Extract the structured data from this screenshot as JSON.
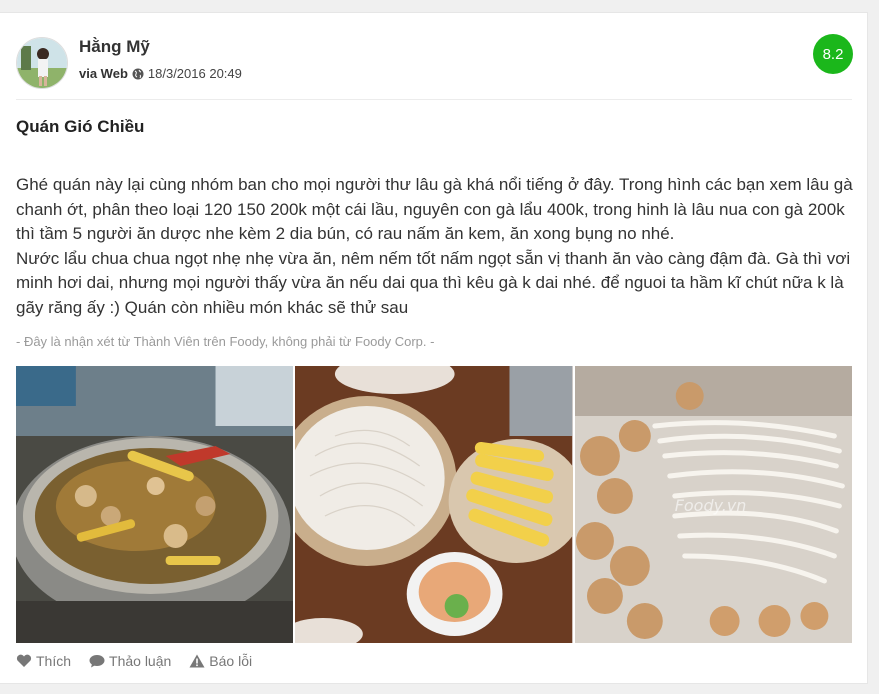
{
  "review": {
    "user": {
      "name": "Hằng Mỹ",
      "via": "via Web",
      "datetime": "18/3/2016 20:49"
    },
    "score": "8.2",
    "title": "Quán Gió Chiều",
    "body": [
      "Ghé quán này lại cùng nhóm ban cho mọi người thư lâu gà khá nổi tiếng ở đây. Trong hình các bạn xem lâu gà chanh ớt, phân theo loại 120 150 200k một cái lầu, nguyên con gà lẩu 400k, trong hinh là lâu nua con gà 200k thì tầm 5 người ăn dược nhe kèm 2 dia bún, có rau nấm ăn kem, ăn xong bụng no nhé.",
      "Nước lẩu chua chua ngọt nhẹ nhẹ vừa ăn, nêm nếm tốt nấm ngọt sẵn vị thanh ăn vào càng đậm đà. Gà thì vơi minh hơi dai, nhưng mọi người thấy vừa ăn nếu dai qua thì kêu gà k dai nhé. để nguoi ta hầm kĩ chút nữa k là gãy răng ấy :) Quán còn nhiều món khác sẽ thử sau"
    ],
    "disclaimer": "- Đây là nhận xét từ Thành Viên trên Foody, không phải từ Foody Corp. -",
    "photos": [
      {
        "icon": "chicken-hotpot-photo"
      },
      {
        "icon": "noodles-corn-photo"
      },
      {
        "icon": "mushroom-meatballs-photo",
        "watermark": "Foody.vn"
      }
    ],
    "actions": {
      "like": "Thích",
      "discuss": "Thảo luận",
      "report": "Báo lỗi"
    }
  },
  "colors": {
    "score_bg": "#1bb71b",
    "text": "#333333",
    "muted": "#9a9a9a",
    "action": "#777777"
  }
}
